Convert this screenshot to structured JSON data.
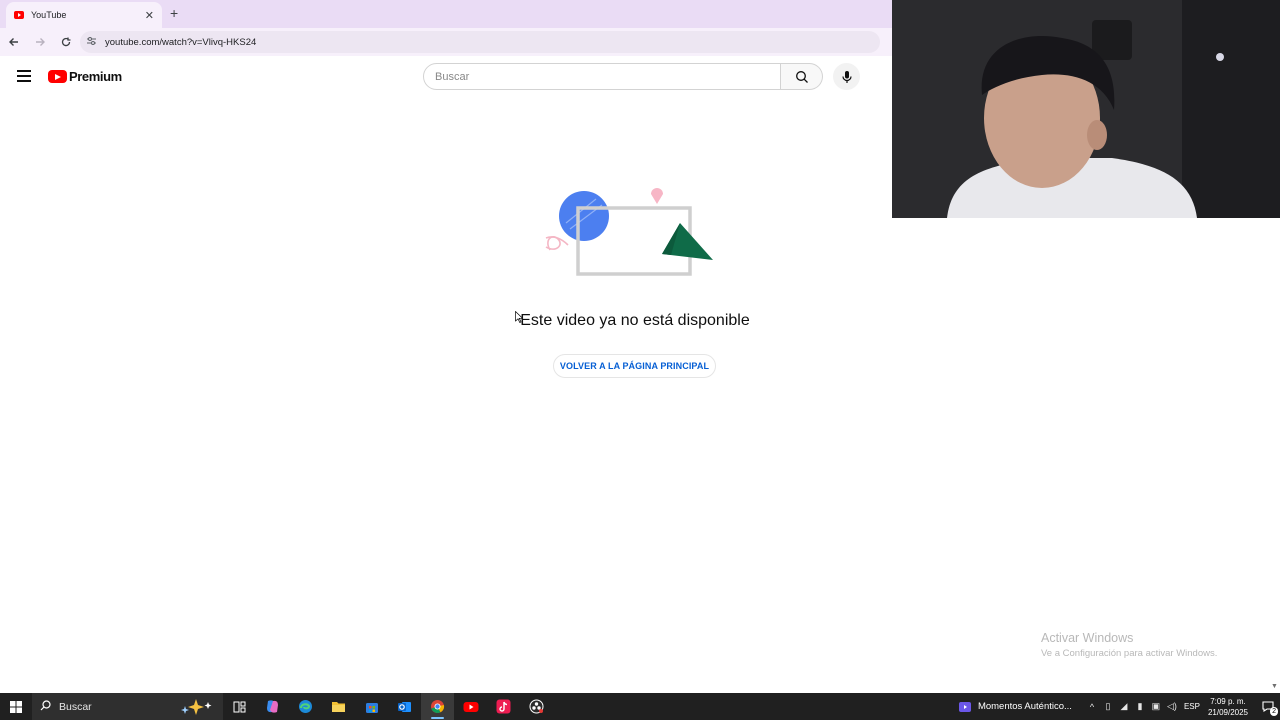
{
  "browser": {
    "tab": {
      "title": "YouTube",
      "close": "✕"
    },
    "new_tab": "+",
    "url": "youtube.com/watch?v=Vlivq-HKS24",
    "icons": [
      "back-icon",
      "forward-icon",
      "reload-icon",
      "site-info-icon"
    ]
  },
  "youtube": {
    "logo_text": "Premium",
    "search_placeholder": "Buscar",
    "error_message": "Este video ya no está disponible",
    "home_button": "VOLVER A LA PÁGINA PRINCIPAL",
    "colors": {
      "brand": "#ff0000",
      "link": "#065fd4"
    }
  },
  "watermark": {
    "title": "Activar Windows",
    "subtitle": "Ve a Configuración para activar Windows."
  },
  "taskbar": {
    "search_label": "Buscar",
    "apps": [
      "task-view-icon",
      "copilot-icon",
      "edge-icon",
      "file-explorer-icon",
      "store-icon",
      "outlook-icon",
      "chrome-icon",
      "youtube-icon",
      "tiktok-icon",
      "obs-icon"
    ],
    "active_app": "chrome-icon",
    "moments_label": "Momentos Auténtico...",
    "language": "ESP",
    "time": "7:09 p. m.",
    "date": "21/09/2025",
    "notification_count": "2"
  }
}
